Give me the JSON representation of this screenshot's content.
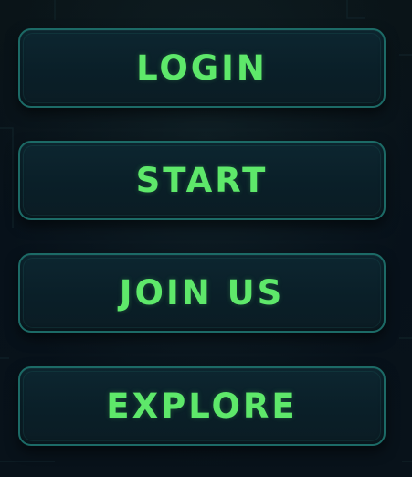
{
  "menu": {
    "buttons": [
      {
        "label": "LOGIN"
      },
      {
        "label": "START"
      },
      {
        "label": "JOIN US"
      },
      {
        "label": "EXPLORE"
      }
    ]
  },
  "colors": {
    "background": "#08121a",
    "button_fill": "#0b2029",
    "button_border": "#1c6a66",
    "label_text": "#5ee86a"
  }
}
